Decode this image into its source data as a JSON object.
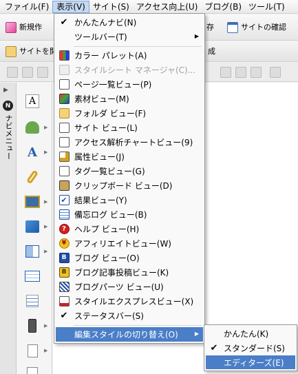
{
  "menubar": {
    "items": [
      "ファイル(F)",
      "表示(V)",
      "サイト(S)",
      "アクセス向上(U)",
      "ブログ(B)",
      "ツール(T)"
    ]
  },
  "toolbar": {
    "new_label": "新規作",
    "save_fragment": "存",
    "site_check_label": "サイトの確認",
    "site_open_fragment": "サイトを開",
    "trailing_fragment": "成"
  },
  "side_panel": {
    "title": "ナビメニュー"
  },
  "view_menu": {
    "items": [
      {
        "label": "かんたんナビ(N)",
        "checked": true
      },
      {
        "label": "ツールバー(T)",
        "submenu": true
      },
      {
        "label": "カラー パレット(A)",
        "icon": "color-palette-icon"
      },
      {
        "label": "スタイルシート マネージャ(C)...",
        "disabled": true,
        "icon": "stylesheet-icon"
      },
      {
        "label": "ページ一覧ビュー(P)",
        "icon": "page-list-icon"
      },
      {
        "label": "素材ビュー(M)",
        "icon": "materials-icon"
      },
      {
        "label": "フォルダ ビュー(F)",
        "icon": "folder-icon"
      },
      {
        "label": "サイト ビュー(L)",
        "icon": "site-view-icon"
      },
      {
        "label": "アクセス解析チャートビュー(9)",
        "icon": "access-chart-icon"
      },
      {
        "label": "属性ビュー(J)",
        "icon": "attributes-icon"
      },
      {
        "label": "タグ一覧ビュー(G)",
        "icon": "tag-list-icon"
      },
      {
        "label": "クリップボード ビュー(D)",
        "icon": "clipboard-icon"
      },
      {
        "label": "結果ビュー(Y)",
        "icon": "results-icon"
      },
      {
        "label": "備忘ログ ビュー(B)",
        "icon": "memo-log-icon"
      },
      {
        "label": "ヘルプ ビュー(H)",
        "icon": "help-icon"
      },
      {
        "label": "アフィリエイトビュー(W)",
        "icon": "affiliate-icon"
      },
      {
        "label": "ブログ ビュー(O)",
        "icon": "blog-icon"
      },
      {
        "label": "ブログ記事投稿ビュー(K)",
        "icon": "blog-post-icon"
      },
      {
        "label": "ブログパーツ ビュー(U)",
        "icon": "blog-parts-icon"
      },
      {
        "label": "スタイルエクスプレスビュー(X)",
        "icon": "style-express-icon"
      },
      {
        "label": "ステータスバー(S)",
        "checked": true
      },
      {
        "label": "編集スタイルの切り替え(O)",
        "submenu": true,
        "highlighted": true
      }
    ]
  },
  "style_submenu": {
    "items": [
      {
        "label": "かんたん(K)",
        "checked": false
      },
      {
        "label": "スタンダード(S)",
        "checked": true
      },
      {
        "label": "エディターズ(E)",
        "highlighted": true
      }
    ]
  },
  "colors": {
    "highlight": "#4a7ec7",
    "menu_bg": "#f9f9f9",
    "menubar_active": "#c6d9f2"
  }
}
